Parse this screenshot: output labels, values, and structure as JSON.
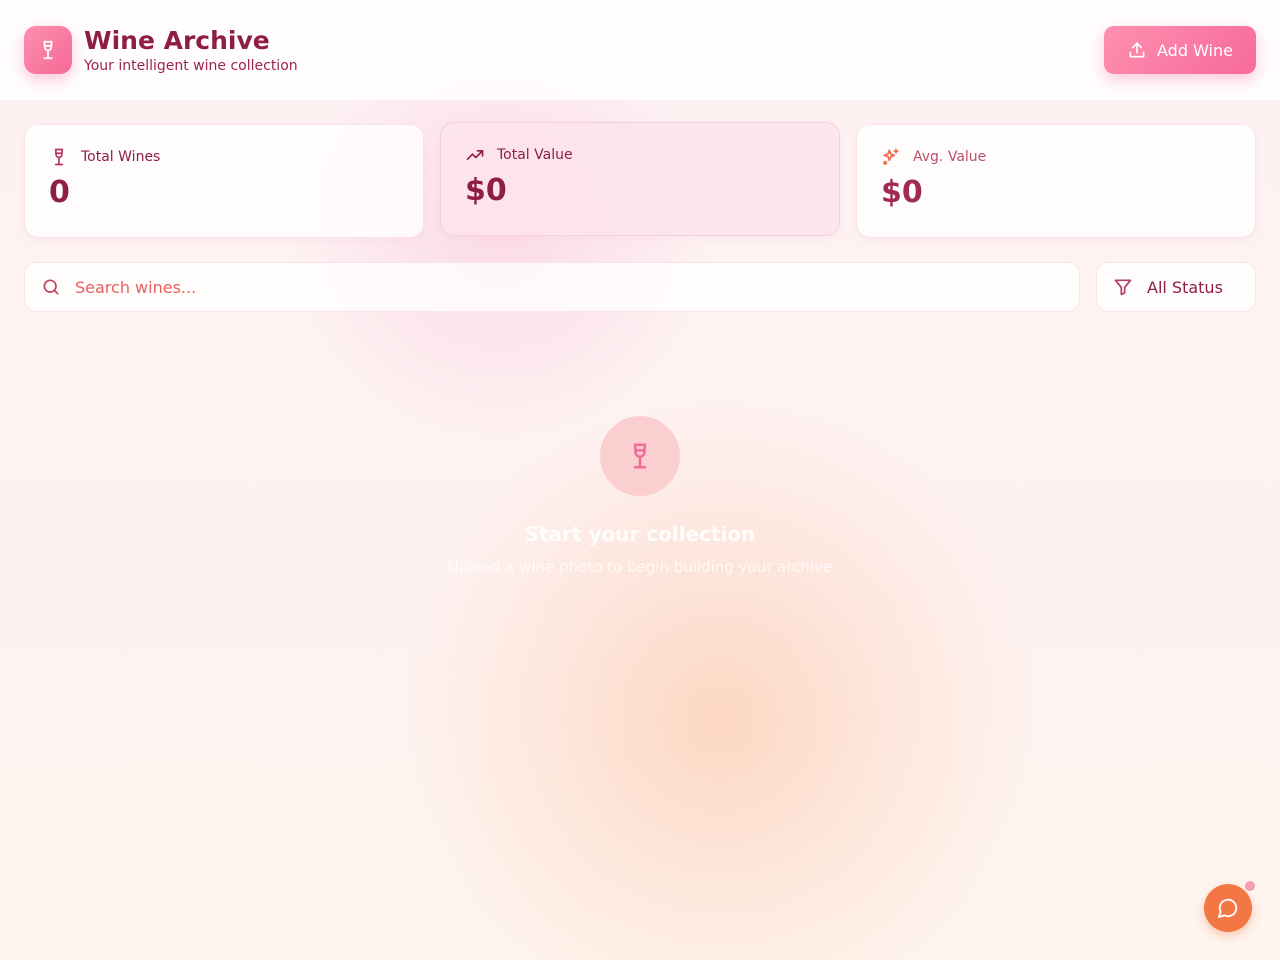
{
  "header": {
    "title": "Wine Archive",
    "subtitle": "Your intelligent wine collection",
    "add_button_label": "Add Wine"
  },
  "stats": [
    {
      "label": "Total Wines",
      "value": "0",
      "icon": "wine-glass-icon"
    },
    {
      "label": "Total Value",
      "value": "$0",
      "icon": "trending-up-icon"
    },
    {
      "label": "Avg. Value",
      "value": "$0",
      "icon": "sparkles-icon"
    }
  ],
  "search": {
    "placeholder": "Search wines...",
    "value": ""
  },
  "filter": {
    "selected": "All Status"
  },
  "empty_state": {
    "title": "Start your collection",
    "subtitle": "Upload a wine photo to begin building your archive",
    "icon": "wine-glass-icon"
  },
  "colors": {
    "primary": "#f46a96",
    "brand_text": "#8e1e44",
    "accent_orange": "#f37744"
  }
}
